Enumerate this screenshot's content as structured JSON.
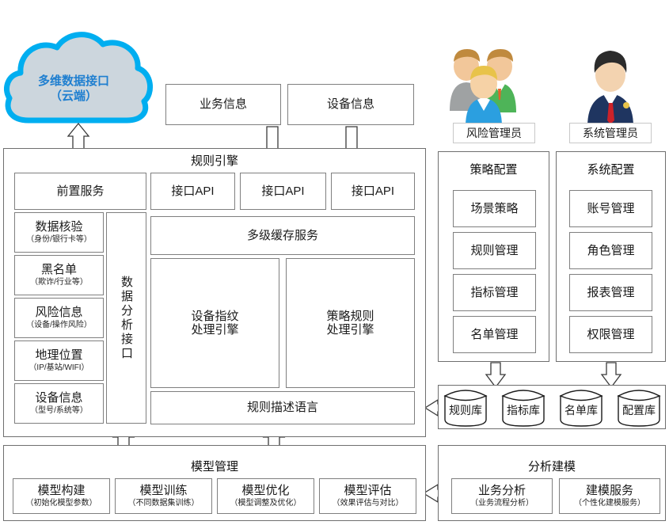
{
  "diagram": {
    "cloud": {
      "line1": "多维数据接口",
      "line2": "（云端）",
      "outline_color": "#00aef0",
      "fill_color": "#ccd6dd",
      "text_color": "#1f7fd0"
    },
    "top_inputs": [
      {
        "label": "业务信息"
      },
      {
        "label": "设备信息"
      }
    ],
    "rule_engine": {
      "title": "规则引擎",
      "front_service": "前置服务",
      "data_sources": [
        {
          "title": "数据核验",
          "sub": "（身份/银行卡等）"
        },
        {
          "title": "黑名单",
          "sub": "（欺诈/行业等）"
        },
        {
          "title": "风险信息",
          "sub": "（设备/操作风险）"
        },
        {
          "title": "地理位置",
          "sub": "（IP/基站/WIFI）"
        },
        {
          "title": "设备信息",
          "sub": "（型号/系统等）"
        }
      ],
      "analysis_interface": "数据分析接口",
      "apis": [
        {
          "label": "接口API"
        },
        {
          "label": "接口API"
        },
        {
          "label": "接口API"
        }
      ],
      "cache_service": "多级缓存服务",
      "engines": [
        {
          "line1": "设备指纹",
          "line2": "处理引擎"
        },
        {
          "line1": "策略规则",
          "line2": "处理引擎"
        }
      ],
      "rule_language": "规则描述语言"
    },
    "actors": [
      {
        "name": "风险管理员",
        "icon": "users-group-icon"
      },
      {
        "name": "系统管理员",
        "icon": "business-person-icon"
      }
    ],
    "config_panels": [
      {
        "title": "策略配置",
        "items": [
          {
            "label": "场景策略"
          },
          {
            "label": "规则管理"
          },
          {
            "label": "指标管理"
          },
          {
            "label": "名单管理"
          }
        ]
      },
      {
        "title": "系统配置",
        "items": [
          {
            "label": "账号管理"
          },
          {
            "label": "角色管理"
          },
          {
            "label": "报表管理"
          },
          {
            "label": "权限管理"
          }
        ]
      }
    ],
    "databases": [
      {
        "label": "规则库"
      },
      {
        "label": "指标库"
      },
      {
        "label": "名单库"
      },
      {
        "label": "配置库"
      }
    ],
    "model_management": {
      "title": "模型管理",
      "items": [
        {
          "title": "模型构建",
          "sub": "（初始化模型参数）"
        },
        {
          "title": "模型训练",
          "sub": "（不同数据集训练）"
        },
        {
          "title": "模型优化",
          "sub": "（模型调整及优化）"
        },
        {
          "title": "模型评估",
          "sub": "（效果评估与对比）"
        }
      ]
    },
    "analysis_modeling": {
      "title": "分析建模",
      "items": [
        {
          "title": "业务分析",
          "sub": "（业务流程分析）"
        },
        {
          "title": "建模服务",
          "sub": "（个性化建模服务）"
        }
      ]
    }
  }
}
